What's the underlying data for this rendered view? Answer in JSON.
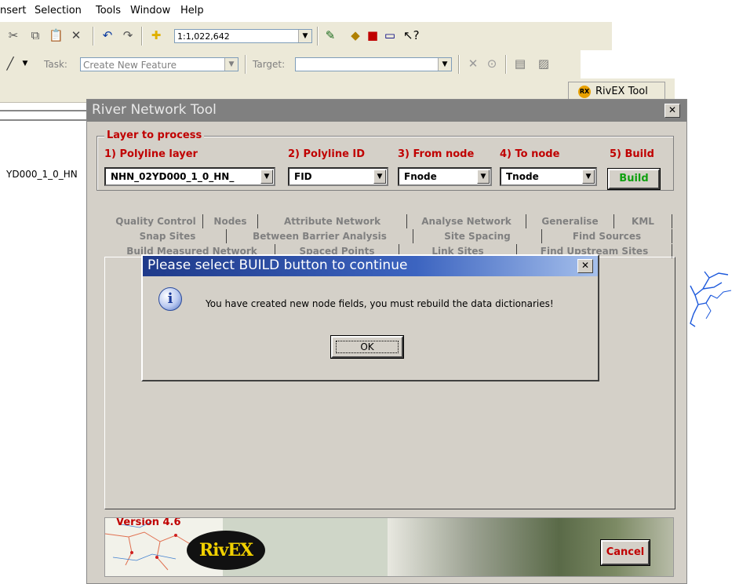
{
  "menubar": {
    "items": [
      "nsert",
      "Selection",
      "Tools",
      "Window",
      "Help"
    ]
  },
  "toolbar1": {
    "scale_value": "1:1,022,642",
    "icons": [
      "cut-icon",
      "copy-icon",
      "paste-icon",
      "delete-icon",
      "undo-icon",
      "redo-icon",
      "add-data-icon",
      "editor-toolbar-icon",
      "arccatalog-icon",
      "arctoolbox-icon",
      "command-line-icon",
      "whats-this-icon"
    ]
  },
  "toolbar2": {
    "task_label": "Task:",
    "task_value": "Create New Feature",
    "target_label": "Target:",
    "target_value": ""
  },
  "toolbar3": {
    "rivex_button_label": "RivEX Tool",
    "rivex_badge": "RX"
  },
  "toc": {
    "layer_name": "YD000_1_0_HN"
  },
  "rivex_dialog": {
    "title": "River Network Tool",
    "group_title": "Layer to process",
    "labels": {
      "polyline_layer": "1) Polyline layer",
      "polyline_id": "2) Polyline ID",
      "from_node": "3) From node",
      "to_node": "4) To node",
      "build": "5) Build"
    },
    "values": {
      "polyline_layer": "NHN_02YD000_1_0_HN_",
      "polyline_id": "FID",
      "from_node": "Fnode",
      "to_node": "Tnode"
    },
    "build_button": "Build",
    "tabs_row1": [
      "Quality Control",
      "Nodes",
      "Attribute Network",
      "Analyse Network",
      "Generalise",
      "KML"
    ],
    "tabs_row2": [
      "Snap Sites",
      "Between Barrier Analysis",
      "Site Spacing",
      "Find Sources"
    ],
    "tabs_row3": [
      "Build Measured Network",
      "Spaced Points",
      "Link Sites",
      "Find Upstream Sites"
    ],
    "version": "Version 4.6",
    "logo_text": "RivEX",
    "cancel_button": "Cancel"
  },
  "message_box": {
    "title": "Please select BUILD button to continue",
    "icon_glyph": "i",
    "text": "You have created new node fields, you must rebuild the data dictionaries!",
    "ok_button": "OK"
  },
  "colors": {
    "label_red": "#c00000",
    "build_green": "#10a010",
    "msg_title_blue": "#1f3a8a"
  }
}
